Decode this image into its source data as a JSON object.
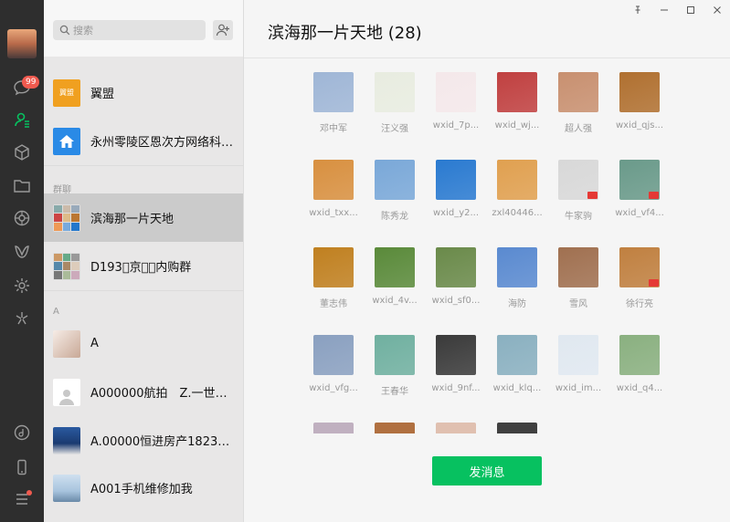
{
  "sidebar": {
    "chat_badge": "99",
    "icons": [
      "chat-icon",
      "contacts-icon",
      "favorites-icon",
      "files-icon",
      "moments-icon",
      "channels-icon",
      "mini-programs-icon",
      "search-discover-icon",
      "music-icon",
      "phone-icon",
      "menu-icon"
    ]
  },
  "search": {
    "placeholder": "搜索"
  },
  "contacts": {
    "top_items": [
      {
        "name": "翼盟",
        "thumb_color": "#f0a020"
      },
      {
        "name": "永州零陵区恩次方网络科…",
        "thumb_color": "#2a8ae6"
      }
    ],
    "group_section_label": "群聊",
    "groups": [
      {
        "name": "滨海那一片天地"
      },
      {
        "name": "D193🏾京东🏾内购群"
      }
    ],
    "a_section_label": "A",
    "a_items": [
      {
        "name": "A"
      },
      {
        "name": "A000000航拍　Z.一世追随"
      },
      {
        "name": "A.00000恒进房产182361…"
      },
      {
        "name": "A001手机维修加我"
      }
    ]
  },
  "main": {
    "title": "滨海那一片天地 (28)",
    "send_button": "发消息",
    "members": [
      {
        "name": "邓中军",
        "color": "#9fb6d6"
      },
      {
        "name": "汪义强",
        "color": "#e8ece0"
      },
      {
        "name": "wxid_7p...",
        "color": "#f4e8ea"
      },
      {
        "name": "wxid_wj...",
        "color": "#c04040"
      },
      {
        "name": "超人强",
        "color": "#c89070"
      },
      {
        "name": "wxid_qjs...",
        "color": "#b07030"
      },
      {
        "name": "wxid_txx...",
        "color": "#d89040"
      },
      {
        "name": "陈秀龙",
        "color": "#7aa8d8"
      },
      {
        "name": "wxid_y2...",
        "color": "#2a7ad0"
      },
      {
        "name": "zxl40446...",
        "color": "#e0a050"
      },
      {
        "name": "牛家驹",
        "color": "#d8d8d8"
      },
      {
        "name": "wxid_vf4...",
        "color": "#6a9a8a"
      },
      {
        "name": "董志伟",
        "color": "#c08020"
      },
      {
        "name": "wxid_4v...",
        "color": "#5a8a3a"
      },
      {
        "name": "wxid_sf0...",
        "color": "#6a8a4a"
      },
      {
        "name": "海防",
        "color": "#5a8ad0"
      },
      {
        "name": "雪风",
        "color": "#a07050"
      },
      {
        "name": "徐行亮",
        "color": "#c08040"
      },
      {
        "name": "wxid_vfg...",
        "color": "#8aa0c0"
      },
      {
        "name": "王春华",
        "color": "#70b0a0"
      },
      {
        "name": "wxid_9nf...",
        "color": "#3a3a3a"
      },
      {
        "name": "wxid_klq...",
        "color": "#8ab0c0"
      },
      {
        "name": "wxid_im...",
        "color": "#e0e8f0"
      },
      {
        "name": "wxid_q4...",
        "color": "#8ab080"
      }
    ],
    "partial_members": [
      {
        "color": "#c0b0c0"
      },
      {
        "color": "#b07040"
      },
      {
        "color": "#e0c0b0"
      },
      {
        "color": "#404040"
      }
    ]
  }
}
